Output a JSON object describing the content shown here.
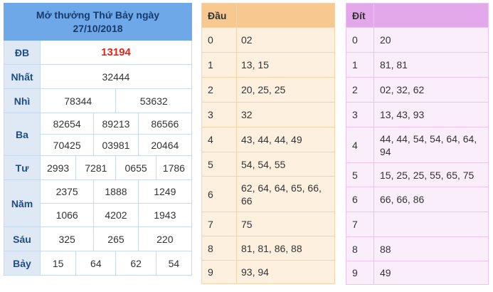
{
  "results": {
    "title_line1": "Mở thưởng Thứ Bảy ngày",
    "title_line2": "27/10/2018",
    "db": {
      "label": "ĐB",
      "value": "13194"
    },
    "nhat": {
      "label": "Nhất",
      "value": "32444"
    },
    "nhi": {
      "label": "Nhì",
      "values": [
        "78344",
        "53632"
      ]
    },
    "ba": {
      "label": "Ba",
      "values": [
        "82654",
        "89213",
        "86566",
        "70425",
        "03981",
        "20464"
      ]
    },
    "tu": {
      "label": "Tư",
      "values": [
        "2993",
        "7281",
        "0655",
        "1786"
      ]
    },
    "nam": {
      "label": "Năm",
      "values": [
        "2375",
        "1888",
        "1249",
        "1066",
        "4202",
        "1943"
      ]
    },
    "sau": {
      "label": "Sáu",
      "values": [
        "325",
        "265",
        "220"
      ]
    },
    "bay": {
      "label": "Bảy",
      "values": [
        "15",
        "64",
        "62",
        "54"
      ]
    }
  },
  "dau": {
    "header": "Đầu",
    "rows": [
      {
        "k": "0",
        "v": "02"
      },
      {
        "k": "1",
        "v": "13, 15"
      },
      {
        "k": "2",
        "v": "20, 25, 25"
      },
      {
        "k": "3",
        "v": "32"
      },
      {
        "k": "4",
        "v": "43, 44, 44, 49"
      },
      {
        "k": "5",
        "v": "54, 54, 55"
      },
      {
        "k": "6",
        "v": "62, 64, 64, 65, 66, 66"
      },
      {
        "k": "7",
        "v": "75"
      },
      {
        "k": "8",
        "v": "81, 81, 86, 88"
      },
      {
        "k": "9",
        "v": "93, 94"
      }
    ]
  },
  "dit": {
    "header": "Đít",
    "rows": [
      {
        "k": "0",
        "v": "20"
      },
      {
        "k": "1",
        "v": "81, 81"
      },
      {
        "k": "2",
        "v": "02, 32, 62"
      },
      {
        "k": "3",
        "v": "13, 43, 93"
      },
      {
        "k": "4",
        "v": "44, 44, 54, 54, 64, 64, 94"
      },
      {
        "k": "5",
        "v": "15, 25, 25, 55, 65, 75"
      },
      {
        "k": "6",
        "v": "66, 66, 86"
      },
      {
        "k": "7",
        "v": ""
      },
      {
        "k": "8",
        "v": "88"
      },
      {
        "k": "9",
        "v": "49"
      }
    ]
  }
}
